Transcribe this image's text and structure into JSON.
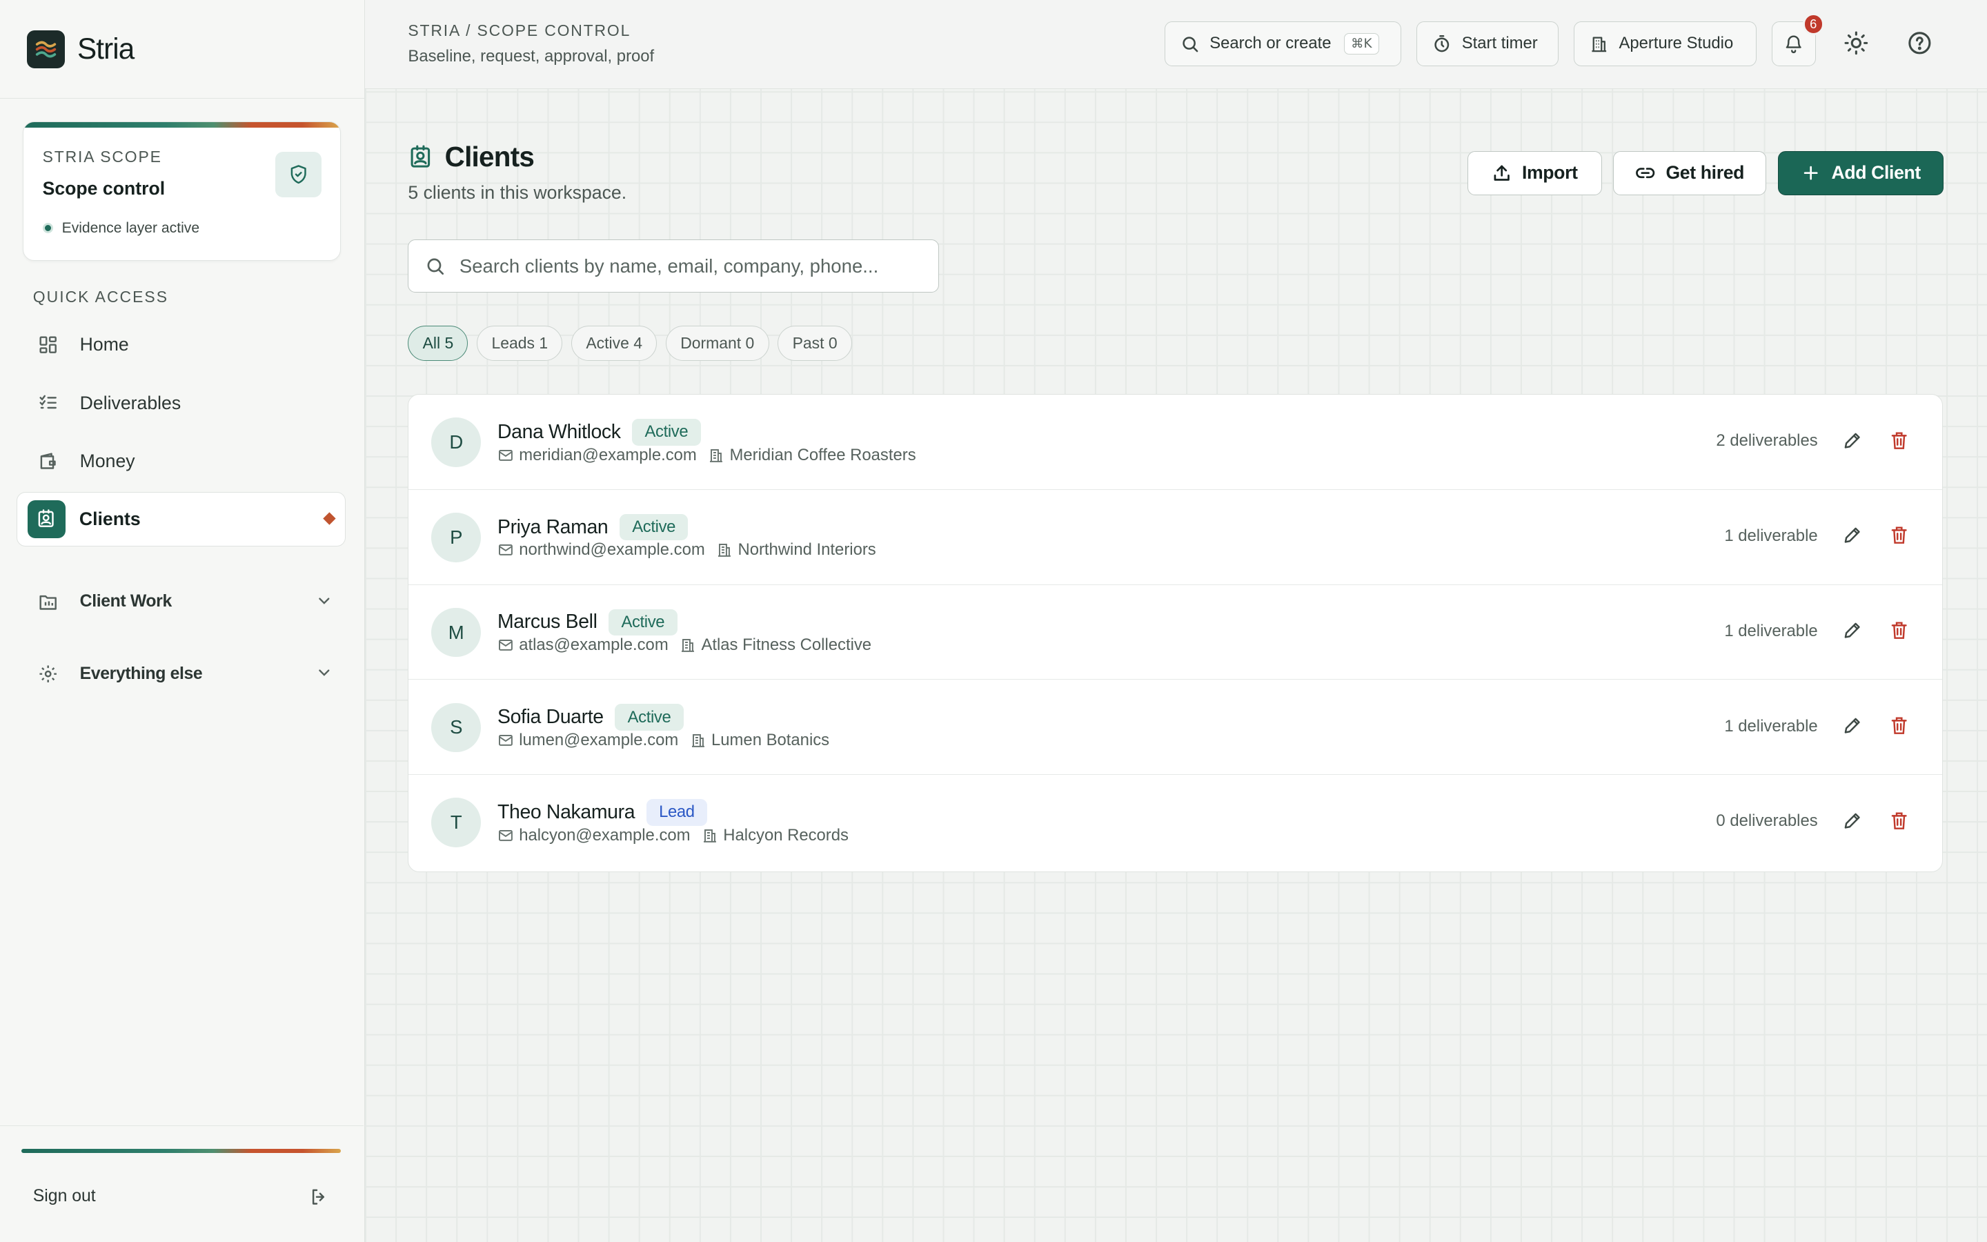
{
  "app": {
    "name": "Stria"
  },
  "scope_card": {
    "eyebrow": "STRIA SCOPE",
    "title": "Scope control",
    "status": "Evidence layer active"
  },
  "sidebar": {
    "section_label": "QUICK ACCESS",
    "items": [
      {
        "label": "Home",
        "icon": "grid-icon"
      },
      {
        "label": "Deliverables",
        "icon": "checklist-icon"
      },
      {
        "label": "Money",
        "icon": "wallet-icon"
      },
      {
        "label": "Clients",
        "icon": "contact-badge-icon",
        "active": true
      }
    ],
    "groups": [
      {
        "label": "Client Work",
        "icon": "folder-icon"
      },
      {
        "label": "Everything else",
        "icon": "gear-icon"
      }
    ],
    "sign_out": "Sign out"
  },
  "topbar": {
    "breadcrumb": "STRIA / SCOPE CONTROL",
    "subtitle": "Baseline, request, approval, proof",
    "search_label": "Search or create",
    "search_shortcut": "⌘K",
    "timer_label": "Start timer",
    "workspace_label": "Aperture Studio",
    "notification_count": "6"
  },
  "page": {
    "title": "Clients",
    "subtitle": "5 clients in this workspace.",
    "import_label": "Import",
    "get_hired_label": "Get hired",
    "add_client_label": "Add Client",
    "search_placeholder": "Search clients by name, email, company, phone..."
  },
  "filters": [
    {
      "label": "All 5",
      "active": true
    },
    {
      "label": "Leads 1"
    },
    {
      "label": "Active 4"
    },
    {
      "label": "Dormant 0"
    },
    {
      "label": "Past 0"
    }
  ],
  "clients": [
    {
      "initial": "D",
      "name": "Dana Whitlock",
      "status": "Active",
      "email": "meridian@example.com",
      "company": "Meridian Coffee Roasters",
      "deliverables": "2 deliverables"
    },
    {
      "initial": "P",
      "name": "Priya Raman",
      "status": "Active",
      "email": "northwind@example.com",
      "company": "Northwind Interiors",
      "deliverables": "1 deliverable"
    },
    {
      "initial": "M",
      "name": "Marcus Bell",
      "status": "Active",
      "email": "atlas@example.com",
      "company": "Atlas Fitness Collective",
      "deliverables": "1 deliverable"
    },
    {
      "initial": "S",
      "name": "Sofia Duarte",
      "status": "Active",
      "email": "lumen@example.com",
      "company": "Lumen Botanics",
      "deliverables": "1 deliverable"
    },
    {
      "initial": "T",
      "name": "Theo Nakamura",
      "status": "Lead",
      "email": "halcyon@example.com",
      "company": "Halcyon Records",
      "deliverables": "0 deliverables"
    }
  ],
  "colors": {
    "brand_green": "#1b6756",
    "danger_red": "#c0392b",
    "lead_blue": "#2b58c5",
    "accent_orange": "#c0542f"
  }
}
